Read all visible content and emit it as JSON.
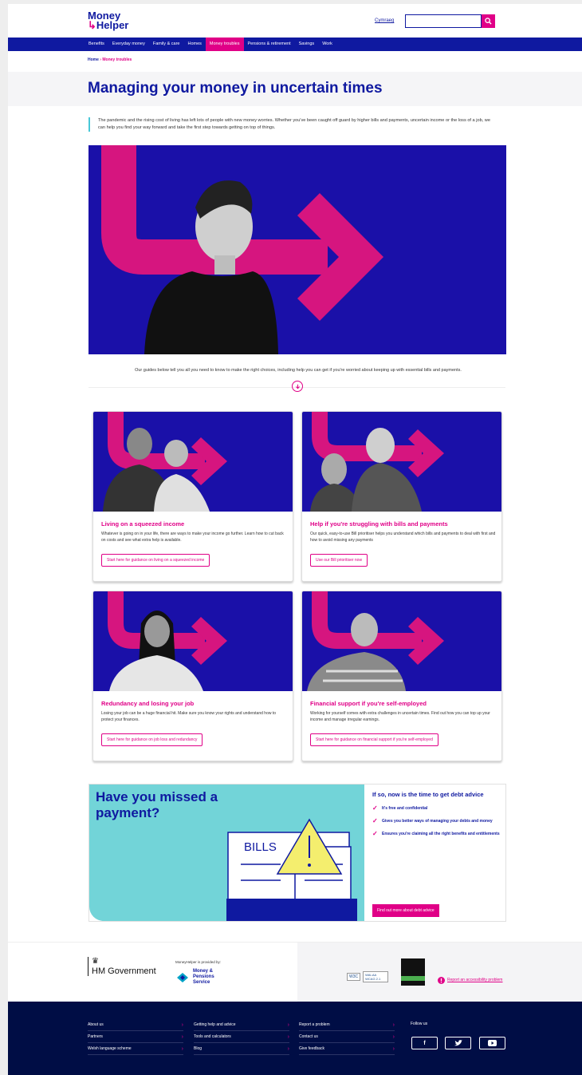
{
  "header": {
    "logo_line1": "Money",
    "logo_line2": "Helper",
    "cymraeg": "Cymraeg",
    "search_placeholder": ""
  },
  "nav": {
    "items": [
      "Benefits",
      "Everyday money",
      "Family & care",
      "Homes",
      "Money troubles",
      "Pensions & retirement",
      "Savings",
      "Work"
    ],
    "active_index": 4
  },
  "breadcrumb": {
    "home": "Home",
    "current": "Money troubles"
  },
  "page_title": "Managing your money in uncertain times",
  "intro": "The pandemic and the rising cost of living has left lots of people with new money worries. Whether you've been caught off guard by higher bills and payments, uncertain income or the loss of a job, we can help you find your way forward and take the first step towards getting on top of things.",
  "guides_text": "Our guides below tell you all you need to know to make the right choices, including help you can get if you're worried about keeping up with essential bills and payments.",
  "cards": [
    {
      "title": "Living on a squeezed income",
      "text": "Whatever is going on in your life, there are ways to make your income go further. Learn how to cut back on costs and see what extra help is available.",
      "button": "Start here for guidance on living on a squeezed income"
    },
    {
      "title": "Help if you're struggling with bills and payments",
      "text": "Our quick, easy-to-use Bill prioritiser helps you understand which bills and payments to deal with first and how to avoid missing any payments",
      "button": "Use our Bill prioritiser now"
    },
    {
      "title": "Redundancy and losing your job",
      "text": "Losing your job can be a huge financial hit. Make sure you know your rights and understand how to protect your finances.",
      "button": "Start here for guidance on job loss and redundancy"
    },
    {
      "title": "Financial support if you're self-employed",
      "text": "Working for yourself comes with extra challenges in uncertain times. Find out how you can top up your income and manage irregular earnings.",
      "button": "Start here for guidance on financial support if you're self-employed"
    }
  ],
  "promo": {
    "heading": "Have you missed a payment?",
    "bills_label": "BILLS",
    "right_title": "If so, now is the time to get debt advice",
    "checks": [
      "It's free and confidential",
      "Gives you better ways of managing your debts and money",
      "Ensures you're claiming all the right benefits and entitlements"
    ],
    "button": "Find out more about debt advice"
  },
  "logos": {
    "hm_government": "HM Government",
    "provided_by": "MoneyHelper is provided by:",
    "mps_line1": "Money &",
    "mps_line2": "Pensions",
    "mps_line3": "Service",
    "w3c": "W3C",
    "wai": "WAI-AA WCAG 2.1",
    "report": "Report an accessibility problem"
  },
  "footer": {
    "col1": [
      "About us",
      "Partners",
      "Welsh language scheme"
    ],
    "col2": [
      "Getting help and advice",
      "Tools and calculators",
      "Blog"
    ],
    "col3": [
      "Report a problem",
      "Contact us",
      "Give feedback"
    ],
    "follow": "Follow us",
    "social": [
      "f",
      "t",
      "yt"
    ]
  },
  "colors": {
    "brand_blue": "#0f19a0",
    "brand_pink": "#e00087",
    "teal": "#72d4d8",
    "footer": "#000d45"
  }
}
